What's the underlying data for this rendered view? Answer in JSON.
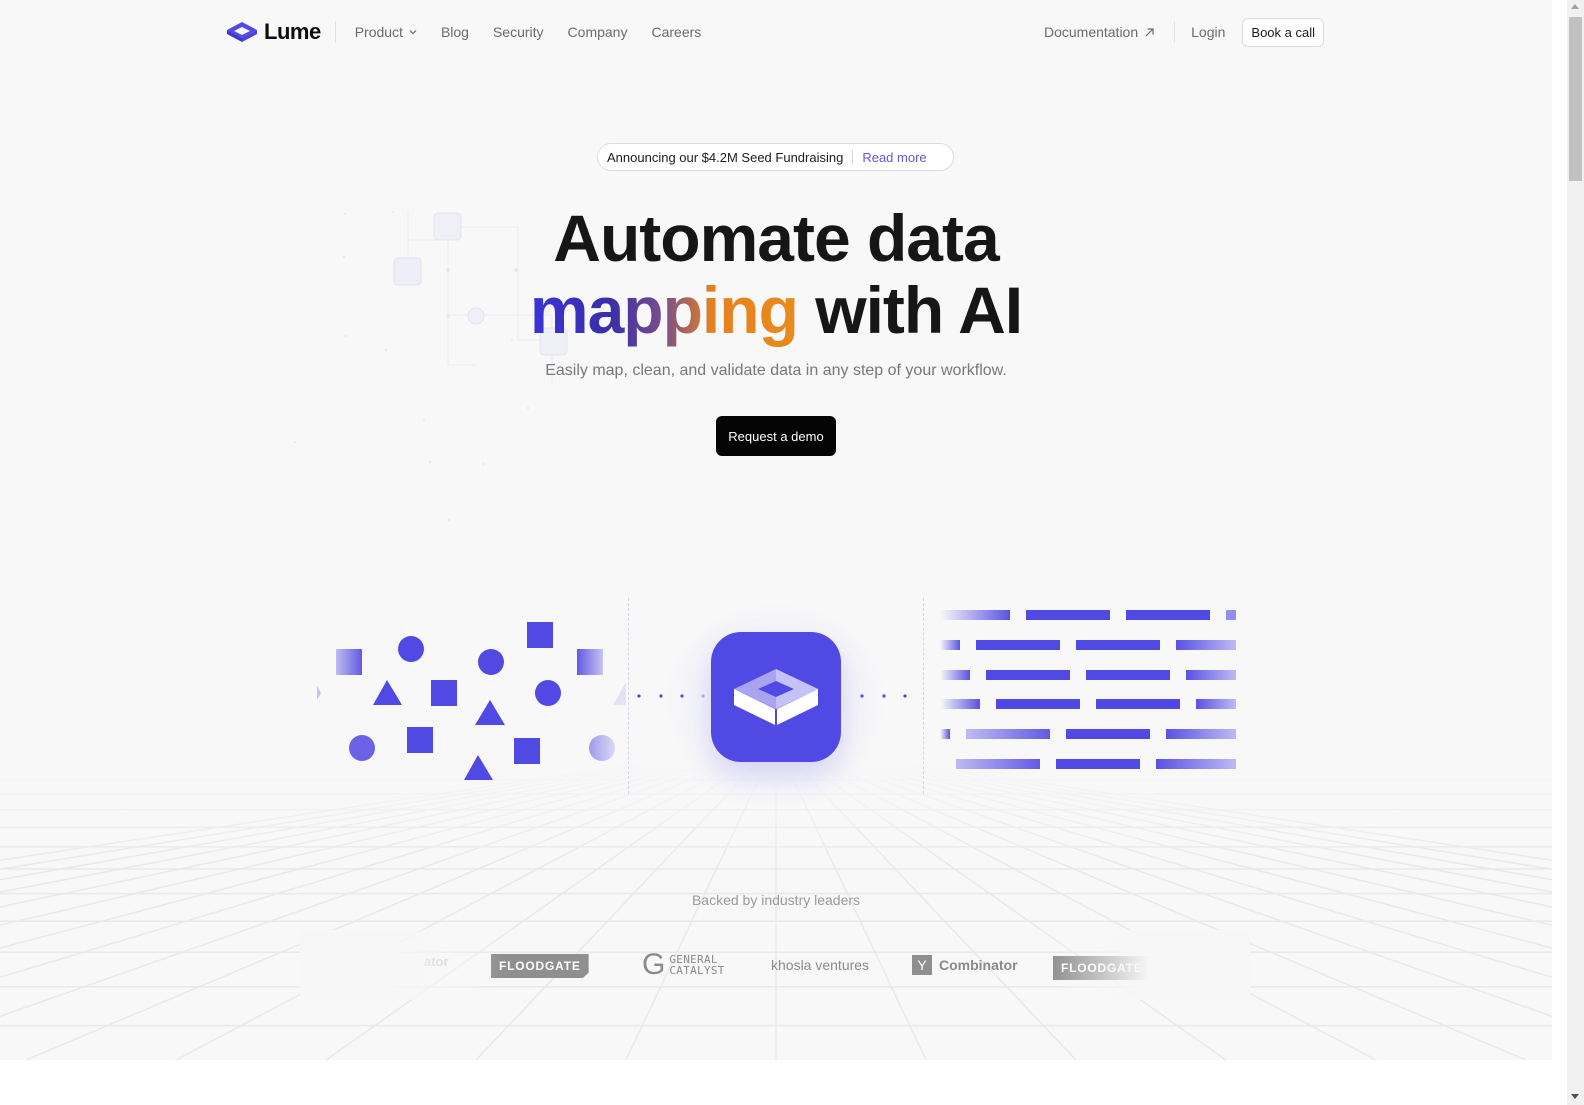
{
  "brand": {
    "name": "Lume",
    "accent_color": "#5149e3",
    "gradient_colors": [
      "#3b35d8",
      "#7a4e8a",
      "#ea8a1c"
    ]
  },
  "nav": {
    "links": [
      {
        "label": "Product",
        "has_dropdown": true
      },
      {
        "label": "Blog"
      },
      {
        "label": "Security"
      },
      {
        "label": "Company"
      },
      {
        "label": "Careers"
      }
    ],
    "documentation_label": "Documentation",
    "login_label": "Login",
    "book_call_label": "Book a call"
  },
  "announcement": {
    "text": "Announcing our $4.2M Seed Fundraising",
    "link_label": "Read more"
  },
  "hero": {
    "headline_line1": "Automate data",
    "headline_highlight": "mapping",
    "headline_line2_rest": " with AI",
    "subtitle": "Easily map, clean, and validate data in any step of your workflow.",
    "cta_label": "Request a demo"
  },
  "illustration": {
    "input_shapes": [
      "square",
      "circle",
      "circle",
      "square",
      "square",
      "triangle",
      "square",
      "circle",
      "triangle",
      "circle",
      "square",
      "square",
      "circle",
      "triangle"
    ],
    "output_rows": 6,
    "shape_color": "#5149e3"
  },
  "backers": {
    "heading": "Backed by industry leaders",
    "logos": [
      {
        "name": "Y Combinator (partial)",
        "text": "ator"
      },
      {
        "name": "Floodgate",
        "text": "FLOODGATE"
      },
      {
        "name": "General Catalyst",
        "text_line1": "GENERAL",
        "text_line2": "CATALYST"
      },
      {
        "name": "Khosla Ventures",
        "text": "khosla ventures"
      },
      {
        "name": "Y Combinator",
        "box": "Y",
        "text": "Combinator"
      },
      {
        "name": "Floodgate (partial)",
        "text": "FLOODGATE"
      }
    ]
  }
}
